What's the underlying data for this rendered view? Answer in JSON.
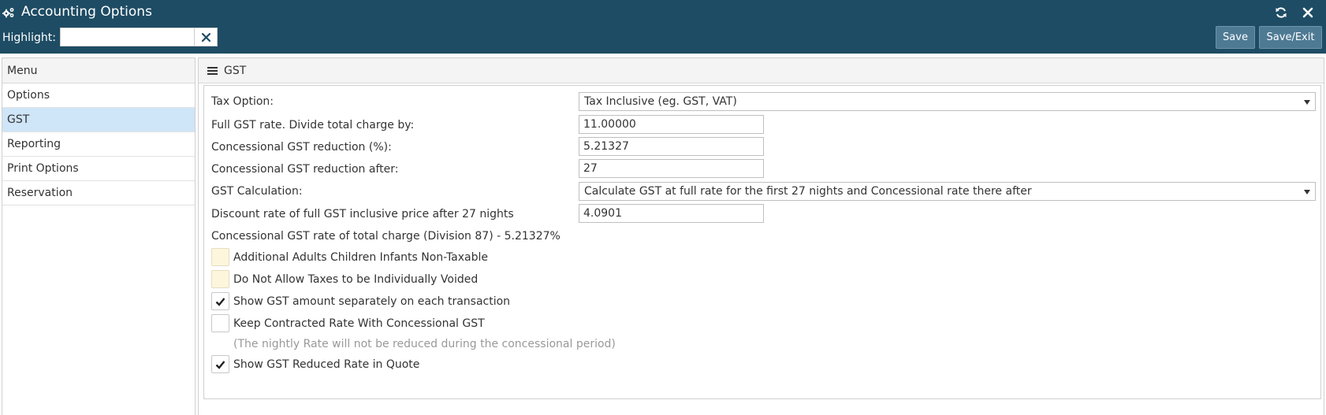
{
  "window": {
    "title": "Accounting Options",
    "icons": {
      "title": "cogs-icon",
      "refresh": "refresh-icon",
      "close": "close-icon"
    }
  },
  "toolbar": {
    "highlight_label": "Highlight:",
    "highlight_value": "",
    "save_label": "Save",
    "save_exit_label": "Save/Exit"
  },
  "sidebar": {
    "header": "Menu",
    "items": [
      {
        "label": "Options",
        "active": false
      },
      {
        "label": "GST",
        "active": true
      },
      {
        "label": "Reporting",
        "active": false
      },
      {
        "label": "Print Options",
        "active": false
      },
      {
        "label": "Reservation",
        "active": false
      }
    ]
  },
  "main": {
    "title": "GST",
    "form": {
      "tax_option_label": "Tax Option:",
      "tax_option_value": "Tax Inclusive (eg. GST, VAT)",
      "full_rate_label": "Full GST rate. Divide total charge by:",
      "full_rate_value": "11.00000",
      "concessional_reduction_label": "Concessional GST reduction (%):",
      "concessional_reduction_value": "5.21327",
      "reduction_after_label": "Concessional GST reduction after:",
      "reduction_after_value": "27",
      "calculation_label": "GST Calculation:",
      "calculation_value": "Calculate GST at full rate for the first 27 nights and Concessional rate there after",
      "discount_rate_label": "Discount rate of full GST inclusive price after 27 nights",
      "discount_rate_value": "4.0901",
      "division_note": "Concessional GST rate of total charge (Division 87) - 5.21327%",
      "checkboxes": [
        {
          "label": "Additional Adults Children Infants Non-Taxable",
          "checked": false
        },
        {
          "label": "Do Not Allow Taxes to be Individually Voided",
          "checked": false
        },
        {
          "label": "Show GST amount separately on each transaction",
          "checked": true
        },
        {
          "label": "Keep Contracted Rate With Concessional GST",
          "checked": false
        },
        {
          "label": "Show GST Reduced Rate in Quote",
          "checked": true
        }
      ],
      "contracted_rate_note": "(The nightly Rate will not be reduced during the concessional period)"
    }
  },
  "colors": {
    "header_bg": "#1e4c64",
    "button_bg": "#4e7a94",
    "active_item_bg": "#cfe5f8",
    "checkbox_cream": "#fdf6dc"
  }
}
